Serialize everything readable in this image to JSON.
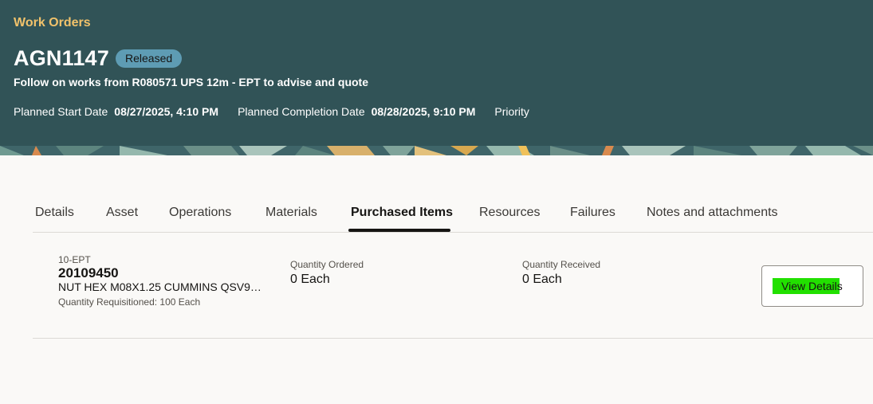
{
  "header": {
    "breadcrumb": "Work Orders",
    "work_order_number": "AGN1147",
    "status": "Released",
    "description": "Follow on works from R080571 UPS 12m - EPT to advise and quote",
    "planned_start_label": "Planned Start Date",
    "planned_start_value": "08/27/2025, 4:10 PM",
    "planned_completion_label": "Planned Completion Date",
    "planned_completion_value": "08/28/2025, 9:10 PM",
    "priority_label": "Priority"
  },
  "tabs": [
    {
      "label": "Details"
    },
    {
      "label": "Asset"
    },
    {
      "label": "Operations"
    },
    {
      "label": "Materials"
    },
    {
      "label": "Purchased Items",
      "active": true
    },
    {
      "label": "Resources"
    },
    {
      "label": "Failures"
    },
    {
      "label": "Notes and attachments"
    }
  ],
  "purchased_items": [
    {
      "operation": "10-EPT",
      "item_number": "20109450",
      "description": "NUT HEX M08X1.25 CUMMINS QSV91...",
      "quantity_requisitioned": "Quantity Requisitioned: 100 Each",
      "quantity_ordered_label": "Quantity Ordered",
      "quantity_ordered_value": "0 Each",
      "quantity_received_label": "Quantity Received",
      "quantity_received_value": "0 Each",
      "action_label": "View Details"
    }
  ],
  "colors": {
    "header_bg": "#315357",
    "breadcrumb": "#f1c26b",
    "status_badge": "#5e9cb4",
    "highlight": "#22e000"
  }
}
